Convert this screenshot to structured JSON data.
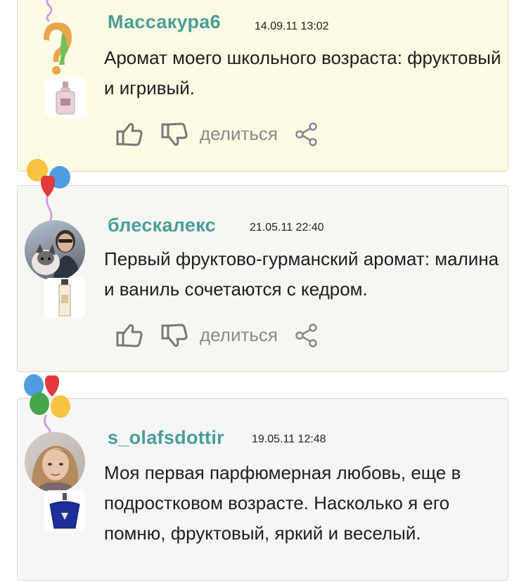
{
  "comments": [
    {
      "username": "Массакура6",
      "timestamp": "14.09.11 13:02",
      "text": "Аромат моего школьного возраста: фруктовый и игривый.",
      "share_label": "делиться"
    },
    {
      "username": "блескалекс",
      "timestamp": "21.05.11 22:40",
      "text": "Первый фруктово-гурманский аромат: малина и ваниль сочетаются с кедром.",
      "share_label": "делиться"
    },
    {
      "username": "s_olafsdottir",
      "timestamp": "19.05.11 12:48",
      "text": "Моя первая парфюмерная любовь, еще в подростковом возрасте. Насколько я его помню, фруктовый, яркий и веселый.",
      "share_label": ""
    }
  ],
  "icons": {
    "like": "thumbs-up-icon",
    "dislike": "thumbs-down-icon",
    "share": "share-icon",
    "avatar_default": "question-profile-icon",
    "decor": "balloons-icon"
  },
  "colors": {
    "username": "#4a9e98",
    "card_highlight": "#fdfbe4",
    "card_default": "#f7f7f2",
    "icon_gray": "#8a8a8a"
  }
}
